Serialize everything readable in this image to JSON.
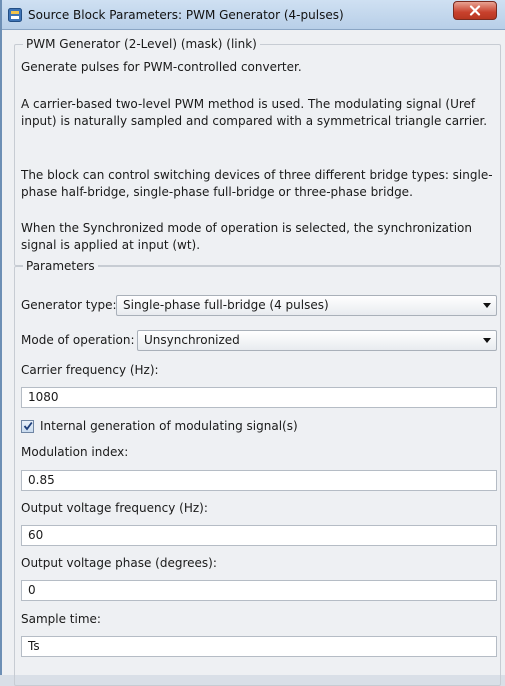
{
  "window": {
    "title": "Source Block Parameters: PWM Generator (4-pulses)",
    "close_glyph": "x"
  },
  "description": {
    "legend": "PWM Generator (2-Level) (mask) (link)",
    "paragraphs": [
      "Generate pulses for PWM-controlled converter.",
      "A carrier-based two-level PWM method is used. The modulating signal (Uref input) is naturally sampled and compared with a symmetrical triangle carrier.",
      "The block can control switching devices of three different bridge types: single-phase half-bridge, single-phase full-bridge or three-phase bridge.",
      "When the Synchronized mode of operation is selected, the synchronization signal is applied at input (wt)."
    ]
  },
  "parameters": {
    "legend": "Parameters",
    "generator_type": {
      "label": "Generator type:",
      "value": "Single-phase full-bridge (4 pulses)"
    },
    "mode": {
      "label": "Mode of operation:",
      "value": "Unsynchronized"
    },
    "carrier_frequency": {
      "label": "Carrier frequency (Hz):",
      "value": "1080"
    },
    "internal_generation": {
      "label": "Internal generation of modulating signal(s)",
      "checked": true
    },
    "modulation_index": {
      "label": "Modulation index:",
      "value": "0.85"
    },
    "output_voltage_frequency": {
      "label": "Output voltage frequency (Hz):",
      "value": "60"
    },
    "output_voltage_phase": {
      "label": "Output voltage phase (degrees):",
      "value": "0"
    },
    "sample_time": {
      "label": "Sample time:",
      "value": "Ts"
    }
  },
  "icons": {
    "app": "simulink-block-icon",
    "close": "close-icon",
    "dropdown": "chevron-down-icon",
    "check": "check-icon"
  },
  "colors": {
    "titlebar": "#b8cfe8",
    "close_button": "#c8412d",
    "panel_background": "#eef0f3"
  }
}
